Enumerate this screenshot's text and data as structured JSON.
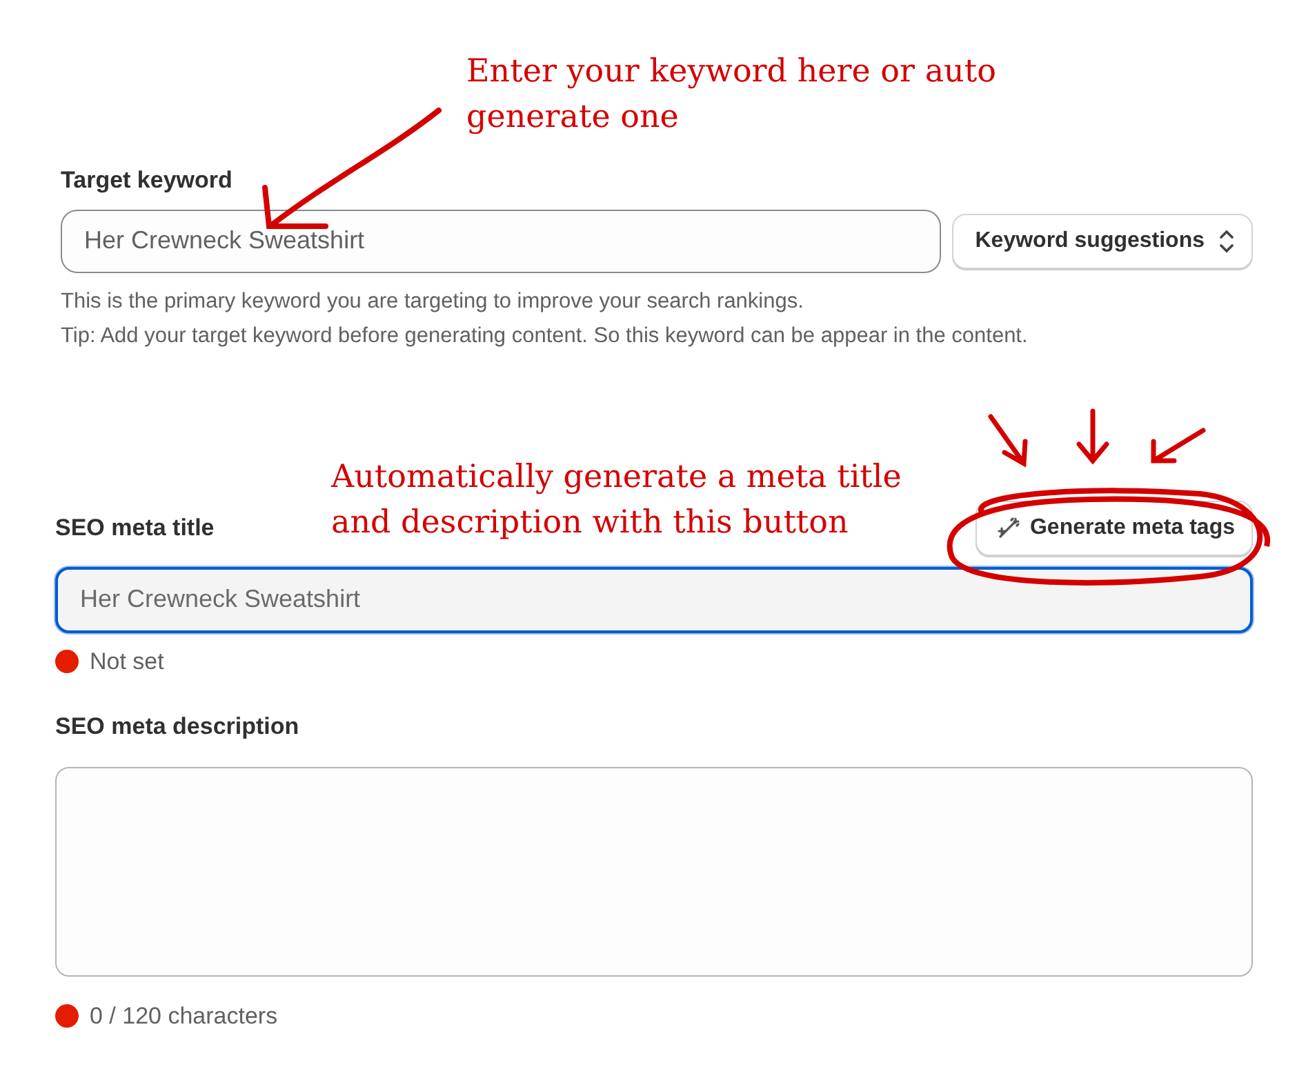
{
  "target_keyword": {
    "label": "Target keyword",
    "value": "Her Crewneck Sweatshirt",
    "suggestions_button": "Keyword suggestions",
    "help": [
      "This is the primary keyword you are targeting to improve your search rankings.",
      "Tip: Add your target keyword before generating content. So this keyword can be appear in the content."
    ]
  },
  "meta_title": {
    "label": "SEO meta title",
    "generate_button": "Generate meta tags",
    "placeholder": "Her Crewneck Sweatshirt",
    "focused": true,
    "status": {
      "text": "Not set",
      "color": "#e51c00"
    }
  },
  "meta_description": {
    "label": "SEO meta description",
    "status": {
      "text": "0 / 120 characters",
      "color": "#e51c00"
    }
  },
  "annotations": [
    {
      "kind": "keyword-note",
      "text": "Enter your keyword here or auto generate one"
    },
    {
      "kind": "button-note",
      "text": "Automatically generate a meta title and description with this button"
    }
  ]
}
